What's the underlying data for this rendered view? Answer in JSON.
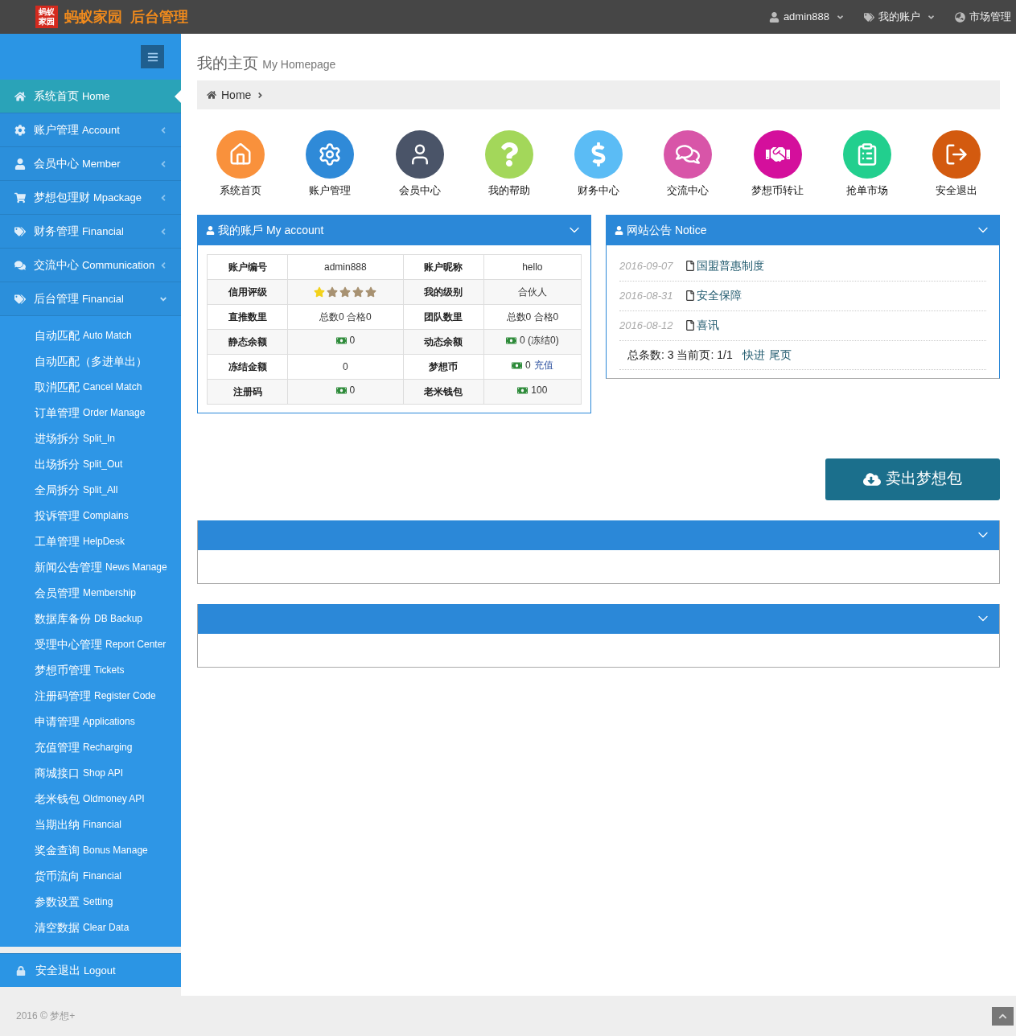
{
  "top_bar": {
    "logo_badge": "蚂蚁家园",
    "title": "蚂蚁家园  后台管理",
    "menus": [
      {
        "label": "admin888"
      },
      {
        "label": "我的账户"
      },
      {
        "label": "市场管理"
      }
    ]
  },
  "sidebar": {
    "items": [
      {
        "kind": "link",
        "label": "系统首页",
        "label_en": "Home",
        "selected": true
      },
      {
        "kind": "group",
        "label": "账户管理",
        "label_en": "Account",
        "selected": false,
        "expanded": false
      },
      {
        "kind": "group",
        "label": "会员中心",
        "label_en": "Member",
        "selected": false,
        "expanded": false
      },
      {
        "kind": "group",
        "label": "梦想包理财",
        "label_en": "Mpackage",
        "selected": false,
        "expanded": false
      },
      {
        "kind": "group",
        "label": "财务管理",
        "label_en": "Financial",
        "selected": false,
        "expanded": false
      },
      {
        "kind": "group",
        "label": "交流中心",
        "label_en": "Communication",
        "selected": false,
        "expanded": false
      },
      {
        "kind": "group",
        "label": "后台管理",
        "label_en": "Financial",
        "selected": false,
        "expanded": true,
        "children": [
          {
            "label": "自动匹配",
            "label_en": "Auto Match"
          },
          {
            "label": "自动匹配（多进单出）"
          },
          {
            "label": "取消匹配",
            "label_en": "Cancel Match"
          },
          {
            "label": "订单管理",
            "label_en": "Order Manage"
          },
          {
            "label": "进场拆分",
            "label_en": "Split_In"
          },
          {
            "label": "出场拆分",
            "label_en": "Split_Out"
          },
          {
            "label": "全局拆分",
            "label_en": "Split_All"
          },
          {
            "label": "投诉管理",
            "label_en": "Complains"
          },
          {
            "label": "工单管理",
            "label_en": "HelpDesk"
          },
          {
            "label": "新闻公告管理",
            "label_en": "News Manage"
          },
          {
            "label": "会员管理",
            "label_en": "Membership"
          },
          {
            "label": "数据库备份",
            "label_en": "DB Backup"
          },
          {
            "label": "受理中心管理",
            "label_en": "Report Center"
          },
          {
            "label": "梦想币管理",
            "label_en": "Tickets"
          },
          {
            "label": "注册码管理",
            "label_en": "Register Code"
          },
          {
            "label": "申请管理",
            "label_en": "Applications"
          },
          {
            "label": "充值管理",
            "label_en": "Recharging"
          },
          {
            "label": "商城接口",
            "label_en": "Shop API"
          },
          {
            "label": "老米钱包",
            "label_en": "Oldmoney API"
          },
          {
            "label": "当期出纳",
            "label_en": "Financial"
          },
          {
            "label": "奖金查询",
            "label_en": "Bonus Manage"
          },
          {
            "label": "货币流向",
            "label_en": "Financial"
          },
          {
            "label": "参数设置",
            "label_en": "Setting"
          },
          {
            "label": "清空数据",
            "label_en": "Clear Data"
          }
        ]
      }
    ],
    "logout": {
      "label": "安全退出",
      "label_en": "Logout"
    }
  },
  "page_header": {
    "title": "我的主页",
    "subtitle": "My Homepage"
  },
  "breadcrumb": [
    "Home"
  ],
  "shortcuts": [
    {
      "label": "系统首页",
      "color": "#f9913c"
    },
    {
      "label": "账户管理",
      "color": "#2f8ad8"
    },
    {
      "label": "会员中心",
      "color": "#4a5468"
    },
    {
      "label": "我的帮助",
      "color": "#a3d75a"
    },
    {
      "label": "财务中心",
      "color": "#5bbcf5"
    },
    {
      "label": "交流中心",
      "color": "#d855a8"
    },
    {
      "label": "梦想币转让",
      "color": "#d40f9c"
    },
    {
      "label": "抢单市场",
      "color": "#22cf8e"
    },
    {
      "label": "安全退出",
      "color": "#d35a0f"
    }
  ],
  "account_panel": {
    "title": "我的账戶",
    "title_en": "My account",
    "rows": [
      [
        {
          "kind": "label",
          "text": "账户编号"
        },
        {
          "kind": "text",
          "text": "admin888"
        },
        {
          "kind": "label",
          "text": "账户昵称"
        },
        {
          "kind": "text",
          "text": "hello"
        }
      ],
      [
        {
          "kind": "label",
          "text": "信用评级"
        },
        {
          "kind": "stars",
          "stars": 1
        },
        {
          "kind": "label",
          "text": "我的级别"
        },
        {
          "kind": "text",
          "text": "合伙人"
        }
      ],
      [
        {
          "kind": "label",
          "text": "直推数里"
        },
        {
          "kind": "text",
          "text": "总数0  合格0"
        },
        {
          "kind": "label",
          "text": "团队数里"
        },
        {
          "kind": "text",
          "text": "总数0  合格0"
        }
      ],
      [
        {
          "kind": "label",
          "text": "静态余额"
        },
        {
          "kind": "money",
          "text": "0"
        },
        {
          "kind": "label",
          "text": "动态余额"
        },
        {
          "kind": "money",
          "text": "0 (冻结0)"
        }
      ],
      [
        {
          "kind": "label",
          "text": "冻结金额"
        },
        {
          "kind": "text",
          "text": "0"
        },
        {
          "kind": "label",
          "text": "梦想币"
        },
        {
          "kind": "money",
          "text": "0",
          "link": "充值"
        }
      ],
      [
        {
          "kind": "label",
          "text": "注册码"
        },
        {
          "kind": "money",
          "text": "0"
        },
        {
          "kind": "label",
          "text": "老米钱包"
        },
        {
          "kind": "money",
          "text": "100"
        }
      ]
    ]
  },
  "notice_panel": {
    "title": "网站公告",
    "title_en": "Notice",
    "items": [
      {
        "date": "2016-09-07",
        "title": "国盟普惠制度"
      },
      {
        "date": "2016-08-31",
        "title": "安全保障"
      },
      {
        "date": "2016-08-12",
        "title": "喜讯"
      }
    ],
    "pager": {
      "summary": "总条数: 3 当前页: 1/1",
      "links": [
        "快进",
        "尾页"
      ]
    }
  },
  "sell_button": "卖出梦想包",
  "footer": {
    "copyright": "2016 © 梦想+"
  }
}
